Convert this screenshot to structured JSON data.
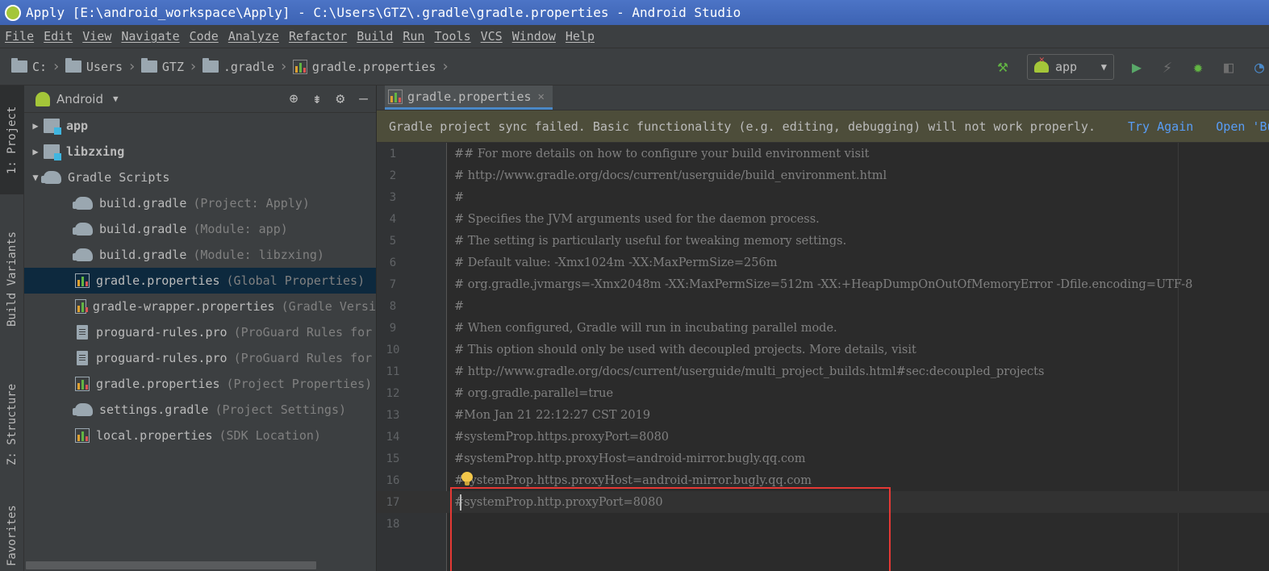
{
  "window": {
    "title": "Apply [E:\\android_workspace\\Apply] - C:\\Users\\GTZ\\.gradle\\gradle.properties - Android Studio"
  },
  "menu": [
    "File",
    "Edit",
    "View",
    "Navigate",
    "Code",
    "Analyze",
    "Refactor",
    "Build",
    "Run",
    "Tools",
    "VCS",
    "Window",
    "Help"
  ],
  "breadcrumb": [
    "C:",
    "Users",
    "GTZ",
    ".gradle",
    "gradle.properties"
  ],
  "toolbar": {
    "run_config": "app"
  },
  "side_tabs": [
    "1: Project",
    "Build Variants",
    "Z: Structure",
    "Favorites"
  ],
  "project": {
    "view_mode": "Android",
    "tree": [
      {
        "name": "app",
        "hint": ""
      },
      {
        "name": "libzxing",
        "hint": ""
      },
      {
        "name": "Gradle Scripts",
        "hint": ""
      },
      {
        "name": "build.gradle",
        "hint": "(Project: Apply)"
      },
      {
        "name": "build.gradle",
        "hint": "(Module: app)"
      },
      {
        "name": "build.gradle",
        "hint": "(Module: libzxing)"
      },
      {
        "name": "gradle.properties",
        "hint": "(Global Properties)"
      },
      {
        "name": "gradle-wrapper.properties",
        "hint": "(Gradle Versi"
      },
      {
        "name": "proguard-rules.pro",
        "hint": "(ProGuard Rules for"
      },
      {
        "name": "proguard-rules.pro",
        "hint": "(ProGuard Rules for"
      },
      {
        "name": "gradle.properties",
        "hint": "(Project Properties)"
      },
      {
        "name": "settings.gradle",
        "hint": "(Project Settings)"
      },
      {
        "name": "local.properties",
        "hint": "(SDK Location)"
      }
    ]
  },
  "editor": {
    "tab": "gradle.properties",
    "banner": {
      "message": "Gradle project sync failed. Basic functionality (e.g. editing, debugging) will not work properly.",
      "try_again": "Try Again",
      "open": "Open 'Bu"
    },
    "lines": [
      {
        "n": "1",
        "text": "## For more details on how to configure your build environment visit"
      },
      {
        "n": "2",
        "text": "# http://www.gradle.org/docs/current/userguide/build_environment.html"
      },
      {
        "n": "3",
        "text": "#"
      },
      {
        "n": "4",
        "text": "# Specifies the JVM arguments used for the daemon process."
      },
      {
        "n": "5",
        "text": "# The setting is particularly useful for tweaking memory settings."
      },
      {
        "n": "6",
        "text": "# Default value: -Xmx1024m -XX:MaxPermSize=256m"
      },
      {
        "n": "7",
        "text": "# org.gradle.jvmargs=-Xmx2048m -XX:MaxPermSize=512m -XX:+HeapDumpOnOutOfMemoryError -Dfile.encoding=UTF-8"
      },
      {
        "n": "8",
        "text": "#"
      },
      {
        "n": "9",
        "text": "# When configured, Gradle will run in incubating parallel mode."
      },
      {
        "n": "10",
        "text": "# This option should only be used with decoupled projects. More details, visit"
      },
      {
        "n": "11",
        "text": "# http://www.gradle.org/docs/current/userguide/multi_project_builds.html#sec:decoupled_projects"
      },
      {
        "n": "12",
        "text": "# org.gradle.parallel=true"
      },
      {
        "n": "13",
        "text": "#Mon Jan 21 22:12:27 CST 2019"
      },
      {
        "n": "14",
        "text": "#systemProp.https.proxyPort=8080"
      },
      {
        "n": "15",
        "text": "#systemProp.http.proxyHost=android-mirror.bugly.qq.com"
      },
      {
        "n": "16",
        "text": "#systemProp.https.proxyHost=android-mirror.bugly.qq.com"
      },
      {
        "n": "17",
        "text": "#systemProp.http.proxyPort=8080"
      },
      {
        "n": "18",
        "text": ""
      }
    ]
  },
  "colors": {
    "selection": "#0d293e",
    "link": "#589df6",
    "annotation": "#e53935"
  }
}
